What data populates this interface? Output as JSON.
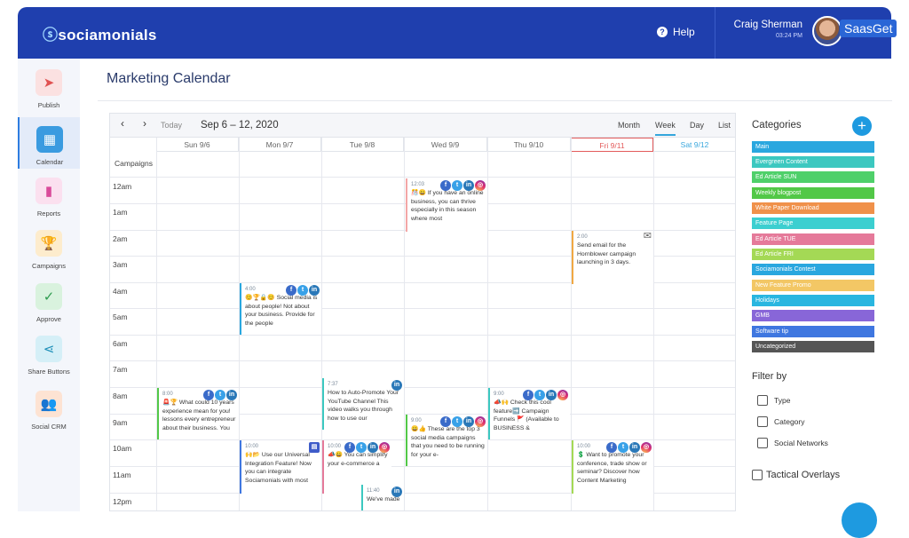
{
  "header": {
    "logo": "sociamonials",
    "help_label": "Help",
    "user_name": "Craig Sherman",
    "user_time": "03:24 PM",
    "watermark": "SaasGet"
  },
  "sidebar": {
    "items": [
      {
        "label": "Publish",
        "icon": "send-icon",
        "color": "#f07b7b"
      },
      {
        "label": "Calendar",
        "icon": "calendar-icon",
        "color": "#3a9be0"
      },
      {
        "label": "Reports",
        "icon": "bar-chart-icon",
        "color": "#e26fb0"
      },
      {
        "label": "Campaigns",
        "icon": "trophy-icon",
        "color": "#f0a843"
      },
      {
        "label": "Approve",
        "icon": "image-check-icon",
        "color": "#4bb96a"
      },
      {
        "label": "Share Buttons",
        "icon": "share-icon",
        "color": "#2ca6cf"
      },
      {
        "label": "Social CRM",
        "icon": "people-icon",
        "color": "#f08a55"
      }
    ]
  },
  "page": {
    "title": "Marketing Calendar"
  },
  "calendar": {
    "today_label": "Today",
    "range": "Sep 6 – 12, 2020",
    "views": [
      "Month",
      "Week",
      "Day",
      "List"
    ],
    "active_view": "Week",
    "days": [
      "Sun 9/6",
      "Mon 9/7",
      "Tue 9/8",
      "Wed 9/9",
      "Thu 9/10",
      "Fri 9/11",
      "Sat 9/12"
    ],
    "campaigns_label": "Campaigns",
    "hours": [
      "12am",
      "1am",
      "2am",
      "3am",
      "4am",
      "5am",
      "6am",
      "7am",
      "8am",
      "9am",
      "10am",
      "11am",
      "12pm"
    ],
    "events": [
      {
        "time": "12:03",
        "text": "🎊😀 If you have an online business, you can thrive especially in this season where most"
      },
      {
        "time": "2:00",
        "text": "Send email for the Hornblower campaign launching in 3 days."
      },
      {
        "time": "4:00",
        "text": "😊🏆🔒😊 Social media is about people! Not about your business. Provide for the people"
      },
      {
        "time": "7:37",
        "text": "How to Auto-Promote Your YouTube Channel This video walks you through how to use our"
      },
      {
        "time": "8:00",
        "text": "🚨🏆 What could 10 years experience mean for you! lessons every entrepreneur about their business. You"
      },
      {
        "time": "9:00",
        "text": "📣🙌 Check this cool feature➡️ Campaign Funnels 🚩 (Available to BUSINESS &"
      },
      {
        "time": "9:00",
        "text": "😀👍 These are the top 3 social media campaigns that you need to be running for your e-"
      },
      {
        "time": "10:00",
        "text": "🙌📂 Use our Universal Integration Feature! Now you can integrate Sociamonials with most"
      },
      {
        "time": "10:00",
        "text": "📣😀 You can simplify your e-commerce a"
      },
      {
        "time": "11:40",
        "text": "We've made"
      },
      {
        "time": "10:00",
        "text": "💲 Want to promote your conference, trade show or seminar? Discover how Content Marketing"
      }
    ]
  },
  "categories": {
    "title": "Categories",
    "items": [
      {
        "label": "Main",
        "color": "#2aa7df"
      },
      {
        "label": "Evergreen Content",
        "color": "#3cc8c0"
      },
      {
        "label": "Ed Article SUN",
        "color": "#4fd06a"
      },
      {
        "label": "Weekly blogpost",
        "color": "#52c847"
      },
      {
        "label": "White Paper Download",
        "color": "#f0914a"
      },
      {
        "label": "Feature Page",
        "color": "#3ccfd0"
      },
      {
        "label": "Ed Article TUE",
        "color": "#e57a9a"
      },
      {
        "label": "Ed Article FRI",
        "color": "#a4d955"
      },
      {
        "label": "Sociamonials Contest",
        "color": "#2aa7df"
      },
      {
        "label": "New Feature Promo",
        "color": "#f3c765"
      },
      {
        "label": "Holidays",
        "color": "#29b6e0"
      },
      {
        "label": "GMB",
        "color": "#8866d8"
      },
      {
        "label": "Software tip",
        "color": "#3f77e0"
      },
      {
        "label": "Uncategorized",
        "color": "#555555"
      }
    ]
  },
  "filter": {
    "title": "Filter by",
    "options": [
      "Type",
      "Category",
      "Social Networks"
    ],
    "overlay_label": "Tactical Overlays"
  }
}
